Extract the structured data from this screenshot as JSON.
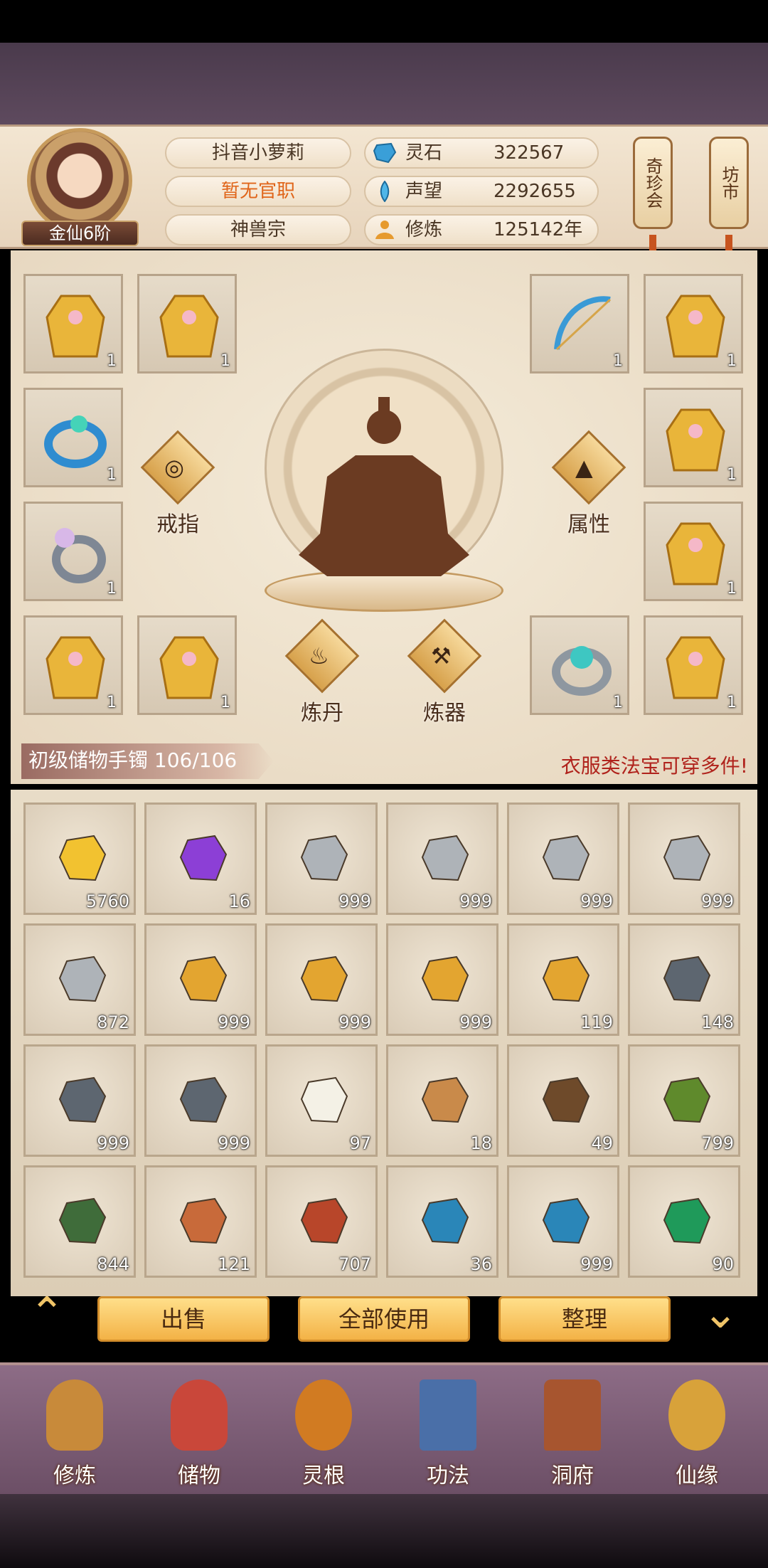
{
  "player": {
    "name": "抖音小萝莉",
    "title": "暂无官职",
    "sect": "神兽宗",
    "rank": "金仙6阶"
  },
  "stats": [
    {
      "label": "灵石",
      "value": "322567",
      "icon": "spirit-stone-icon"
    },
    {
      "label": "声望",
      "value": "2292655",
      "icon": "prestige-icon"
    },
    {
      "label": "修炼",
      "value": "125142年",
      "icon": "cultivation-icon"
    }
  ],
  "side_buttons": {
    "rare_shop": "奇珍会",
    "market": "坊市"
  },
  "equipment": {
    "ring_button": "戒指",
    "attribute_button": "属性",
    "alchemy_button": "炼丹",
    "forge_button": "炼器",
    "slots": [
      {
        "icon": "robe-icon",
        "count": "1"
      },
      {
        "icon": "robe-icon",
        "count": "1"
      },
      {
        "icon": "bow-icon",
        "count": "1"
      },
      {
        "icon": "robe-icon",
        "count": "1"
      },
      {
        "icon": "jade-ring-icon",
        "count": "1"
      },
      {
        "icon": "robe-icon",
        "count": "1"
      },
      {
        "icon": "pearl-ring-icon",
        "count": "1"
      },
      {
        "icon": "robe-icon",
        "count": "1"
      },
      {
        "icon": "robe-icon",
        "count": "1"
      },
      {
        "icon": "robe-icon",
        "count": "1"
      },
      {
        "icon": "turquoise-ring-icon",
        "count": "1"
      },
      {
        "icon": "robe-icon",
        "count": "1"
      }
    ]
  },
  "bag": {
    "title": "初级储物手镯 106/106",
    "note": "衣服类法宝可穿多件!",
    "items": [
      {
        "icon": "gold-talisman-icon",
        "count": "5760",
        "color": "#f2c230"
      },
      {
        "icon": "purple-orb-icon",
        "count": "16",
        "color": "#8c3fd6"
      },
      {
        "icon": "silver-ore-icon",
        "count": "999",
        "color": "#aeb3b8"
      },
      {
        "icon": "silver-ore-icon",
        "count": "999",
        "color": "#aeb3b8"
      },
      {
        "icon": "silver-ore-icon",
        "count": "999",
        "color": "#aeb3b8"
      },
      {
        "icon": "silver-ore-icon",
        "count": "999",
        "color": "#aeb3b8"
      },
      {
        "icon": "silver-ore-icon",
        "count": "872",
        "color": "#aeb3b8"
      },
      {
        "icon": "gold-ore-icon",
        "count": "999",
        "color": "#e3a530"
      },
      {
        "icon": "gold-ore-icon",
        "count": "999",
        "color": "#e3a530"
      },
      {
        "icon": "gold-ore-icon",
        "count": "999",
        "color": "#e3a530"
      },
      {
        "icon": "gold-ore-icon",
        "count": "119",
        "color": "#e3a530"
      },
      {
        "icon": "dark-ore-icon",
        "count": "148",
        "color": "#5d6670"
      },
      {
        "icon": "dark-ore-icon",
        "count": "999",
        "color": "#5d6670"
      },
      {
        "icon": "dark-ore-icon",
        "count": "999",
        "color": "#5d6670"
      },
      {
        "icon": "white-flower-icon",
        "count": "97",
        "color": "#f4f1e6"
      },
      {
        "icon": "ginseng-icon",
        "count": "18",
        "color": "#c98a4a"
      },
      {
        "icon": "herb-root-icon",
        "count": "49",
        "color": "#6e4a2a"
      },
      {
        "icon": "red-berry-herb-icon",
        "count": "799",
        "color": "#5f8a2c"
      },
      {
        "icon": "fruit-branch-icon",
        "count": "844",
        "color": "#3f6c3a"
      },
      {
        "icon": "cordyceps-icon",
        "count": "121",
        "color": "#c86a3a"
      },
      {
        "icon": "red-crystal-icon",
        "count": "707",
        "color": "#b8462a"
      },
      {
        "icon": "blue-crystal-icon",
        "count": "36",
        "color": "#2a86b8"
      },
      {
        "icon": "blue-crystal-icon",
        "count": "999",
        "color": "#2a86b8"
      },
      {
        "icon": "green-crystal-icon",
        "count": "90",
        "color": "#1f9a5a"
      }
    ]
  },
  "actions": {
    "sell": "出售",
    "use_all": "全部使用",
    "sort": "整理"
  },
  "nav": [
    {
      "label": "修炼",
      "icon": "cultivate-nav-icon",
      "color": "#c88a3a"
    },
    {
      "label": "储物",
      "icon": "storage-bag-nav-icon",
      "color": "#c9473a"
    },
    {
      "label": "灵根",
      "icon": "spirit-root-nav-icon",
      "color": "#d17b22"
    },
    {
      "label": "功法",
      "icon": "book-nav-icon",
      "color": "#4a6fa8"
    },
    {
      "label": "洞府",
      "icon": "cave-mansion-nav-icon",
      "color": "#a7552f"
    },
    {
      "label": "仙缘",
      "icon": "gourd-nav-icon",
      "color": "#d8a23a"
    }
  ]
}
